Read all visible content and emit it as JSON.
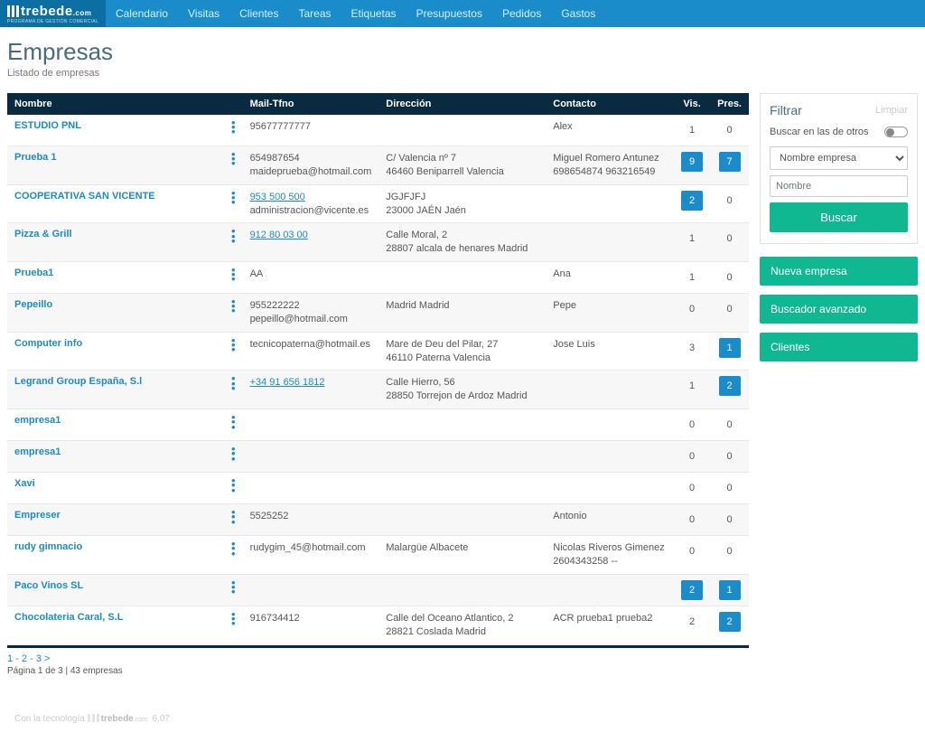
{
  "brand": {
    "name": "trebede",
    "suffix": ".com",
    "tagline": "PROGRAMA DE GESTIÓN COMERCIAL"
  },
  "nav": [
    "Calendario",
    "Visitas",
    "Clientes",
    "Tareas",
    "Etiquetas",
    "Presupuestos",
    "Pedidos",
    "Gastos"
  ],
  "page": {
    "title": "Empresas",
    "subtitle": "Listado de empresas"
  },
  "table": {
    "headers": {
      "nombre": "Nombre",
      "mail": "Mail-Tfno",
      "direccion": "Dirección",
      "contacto": "Contacto",
      "vis": "Vis.",
      "pres": "Pres."
    },
    "rows": [
      {
        "name": "ESTUDIO PNL",
        "mail1": "95677777777",
        "mail2": "",
        "dir1": "",
        "dir2": "",
        "cont1": "Alex",
        "cont2": "",
        "vis": "1",
        "visH": false,
        "pres": "0",
        "presH": false
      },
      {
        "name": "Prueba 1",
        "mail1": "654987654",
        "mail2": "maideprueba@hotmail.com",
        "dir1": "C/ Valencia nº 7",
        "dir2": "46460 Beniparrell Valencia",
        "cont1": "Miguel Romero Antunez",
        "cont2": "698654874 963216549",
        "vis": "9",
        "visH": true,
        "pres": "7",
        "presH": true
      },
      {
        "name": "COOPERATIVA SAN VICENTE",
        "mail1": "953 500 500",
        "mail1Link": true,
        "mail2": "administracion@vicente.es",
        "dir1": "JGJFJFJ",
        "dir2": "23000 JAÉN Jaén",
        "cont1": "",
        "cont2": "",
        "vis": "2",
        "visH": true,
        "pres": "0",
        "presH": false
      },
      {
        "name": "Pizza & Grill",
        "mail1": "912 80 03 00",
        "mail1Link": true,
        "mail2": "",
        "dir1": "Calle Moral, 2",
        "dir2": "28807 alcala de henares Madrid",
        "cont1": "",
        "cont2": "",
        "vis": "1",
        "visH": false,
        "pres": "0",
        "presH": false
      },
      {
        "name": "Prueba1",
        "mail1": "AA",
        "mail2": "",
        "dir1": "",
        "dir2": "",
        "cont1": "Ana",
        "cont2": "",
        "vis": "1",
        "visH": false,
        "pres": "0",
        "presH": false
      },
      {
        "name": "Pepeillo",
        "mail1": "955222222",
        "mail2": "pepeillo@hotmail.com",
        "dir1": "Madrid Madrid",
        "dir2": "",
        "cont1": "Pepe",
        "cont2": "",
        "vis": "0",
        "visH": false,
        "pres": "0",
        "presH": false
      },
      {
        "name": "Computer info",
        "mail1": "",
        "mail2": "tecnicopaterna@hotmail.es",
        "dir1": "Mare de Deu del Pilar, 27",
        "dir2": "46110 Paterna Valencia",
        "cont1": "Jose Luis",
        "cont2": "",
        "vis": "3",
        "visH": false,
        "pres": "1",
        "presH": true
      },
      {
        "name": "Legrand Group España, S.l",
        "mail1": "+34 91 656 1812",
        "mail1Link": true,
        "mail2": "",
        "dir1": "Calle Hierro, 56",
        "dir2": "28850 Torrejon de Ardoz Madrid",
        "cont1": "",
        "cont2": "",
        "vis": "1",
        "visH": false,
        "pres": "2",
        "presH": true
      },
      {
        "name": "empresa1",
        "mail1": "",
        "mail2": "",
        "dir1": "",
        "dir2": "",
        "cont1": "",
        "cont2": "",
        "vis": "0",
        "visH": false,
        "pres": "0",
        "presH": false
      },
      {
        "name": "empresa1",
        "mail1": "",
        "mail2": "",
        "dir1": "",
        "dir2": "",
        "cont1": "",
        "cont2": "",
        "vis": "0",
        "visH": false,
        "pres": "0",
        "presH": false
      },
      {
        "name": "Xavi",
        "mail1": "",
        "mail2": "",
        "dir1": "",
        "dir2": "",
        "cont1": "",
        "cont2": "",
        "vis": "0",
        "visH": false,
        "pres": "0",
        "presH": false
      },
      {
        "name": "Empreser",
        "mail1": "5525252",
        "mail2": "",
        "dir1": "",
        "dir2": "",
        "cont1": "Antonio",
        "cont2": "",
        "vis": "0",
        "visH": false,
        "pres": "0",
        "presH": false
      },
      {
        "name": "rudy gimnacio",
        "mail1": "",
        "mail2": "rudygim_45@hotmail.com",
        "dir1": "Malargüe Albacete",
        "dir2": "",
        "cont1": "Nicolas Riveros Gimenez",
        "cont2": "2604343258 --",
        "vis": "0",
        "visH": false,
        "pres": "0",
        "presH": false
      },
      {
        "name": "Paco Vinos SL",
        "mail1": "",
        "mail2": "",
        "dir1": "",
        "dir2": "",
        "cont1": "",
        "cont2": "",
        "vis": "2",
        "visH": true,
        "pres": "1",
        "presH": true
      },
      {
        "name": "Chocolateria Caral, S.L",
        "mail1": "916734412",
        "mail2": "",
        "dir1": "Calle del Oceano Atlantico, 2",
        "dir2": "28821 Coslada Madrid",
        "cont1": "ACR prueba1 prueba2",
        "cont2": "",
        "vis": "2",
        "visH": false,
        "pres": "2",
        "presH": true
      }
    ]
  },
  "pager": {
    "p1": "1",
    "sep": " - ",
    "p2": "2",
    "p3": "3",
    "next": ">",
    "info": "Página 1 de 3 | 43 empresas"
  },
  "filter": {
    "title": "Filtrar",
    "clear": "Limpiar",
    "toggleLabel": "Buscar en las de otros",
    "selectLabel": "Nombre empresa",
    "inputPlaceholder": "Nombre",
    "buscar": "Buscar",
    "btn1": "Nueva empresa",
    "btn2": "Buscador avanzado",
    "btn3": "Clientes"
  },
  "footer": {
    "prefix": "Con la tecnología ",
    "brand": "trebede",
    "suffix": ".com",
    "ver": "6.07"
  }
}
